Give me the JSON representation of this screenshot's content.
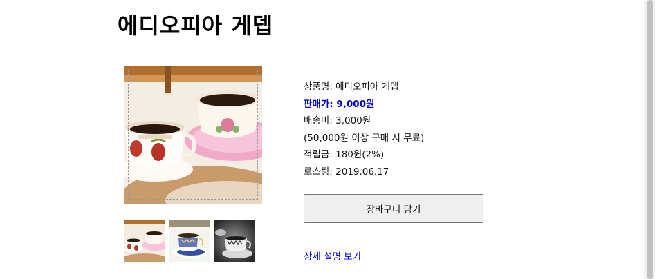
{
  "page": {
    "title": "에디오피아 게뎁"
  },
  "gallery": {
    "main_image": "coffee-cups-photo",
    "thumbnails": [
      "coffee-cups-thumb",
      "blue-pattern-cup-thumb",
      "monochrome-cup-thumb"
    ]
  },
  "product": {
    "name_line": "상품명: 에디오피아 게뎁",
    "price_line": "판매가: 9,000원",
    "shipping_line": "배송비: 3,000원",
    "free_shipping_line": "(50,000원 이상 구매 시 무료)",
    "points_line": "적립금: 180원(2%)",
    "roasting_line": "로스팅: 2019.06.17"
  },
  "actions": {
    "cart_label": "장바구니 담기",
    "detail_label": "상세 설명 보기"
  },
  "colors": {
    "price": "#0000cc",
    "link": "#0000cc",
    "button_bg": "#efefef"
  }
}
